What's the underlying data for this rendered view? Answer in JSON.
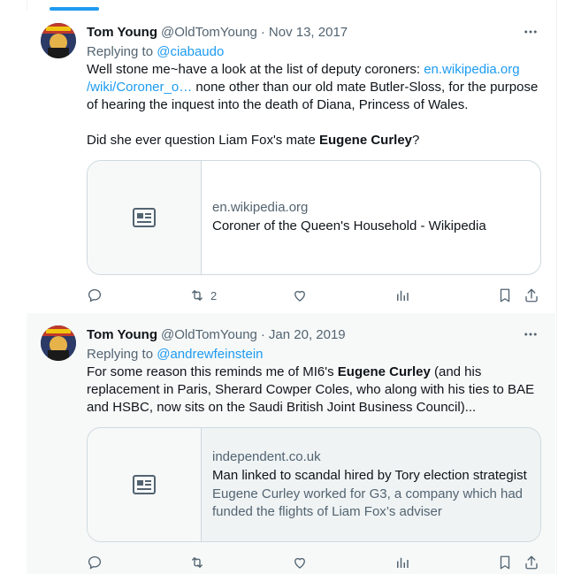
{
  "tweets": [
    {
      "name": "Tom Young",
      "handle": "@OldTomYoung",
      "dot": "·",
      "time": "Nov 13, 2017",
      "replying_prefix": "Replying to ",
      "replying_to": "@ciabaudo",
      "text_1": "Well stone me~have a look at the list of deputy coroners: ",
      "link_1": "en.wikipedia.org",
      "link_2": "/wiki/Coroner_o…",
      "text_2": " none other than our old mate Butler-Sloss, for the purpose of hearing the inquest into the death of Diana, Princess of Wales.",
      "text_3": "Did she ever question Liam Fox's mate ",
      "bold_1": "Eugene Curley",
      "text_4": "?",
      "card": {
        "domain": "en.wikipedia.org",
        "title": "Coroner of the Queen's Household - Wikipedia"
      },
      "retweet_count": "2",
      "icons": [
        "reply-icon",
        "retweet-icon",
        "like-icon",
        "views-icon",
        "bookmark-icon",
        "share-icon"
      ]
    },
    {
      "name": "Tom Young",
      "handle": "@OldTomYoung",
      "dot": "·",
      "time": "Jan 20, 2019",
      "replying_prefix": "Replying to ",
      "replying_to": "@andrewfeinstein",
      "text_1": "For some reason this reminds me of MI6's ",
      "bold_1": "Eugene Curley",
      "text_2": " (and his replacement in Paris, Sherard Cowper Coles, who along with his ties to BAE and HSBC, now sits on the Saudi British Joint Business Council)...",
      "card": {
        "domain": "independent.co.uk",
        "title": "Man linked to scandal hired by Tory election strategist",
        "description": "Eugene Curley worked for G3, a company which had funded the flights of Liam Fox’s adviser"
      },
      "icons": [
        "reply-icon",
        "retweet-icon",
        "like-icon",
        "views-icon",
        "bookmark-icon",
        "share-icon"
      ]
    }
  ],
  "colors": {
    "accent": "#1d9bf0",
    "secondary_text": "#536471",
    "border": "#cfd9de"
  }
}
